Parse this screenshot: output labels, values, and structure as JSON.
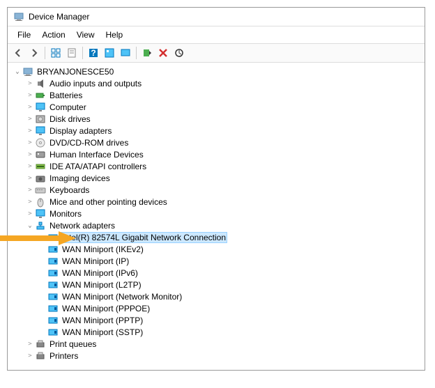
{
  "window": {
    "title": "Device Manager"
  },
  "menubar": {
    "items": [
      "File",
      "Action",
      "View",
      "Help"
    ]
  },
  "toolbar": {
    "buttons": [
      {
        "name": "back-icon"
      },
      {
        "name": "forward-icon"
      },
      {
        "sep": true
      },
      {
        "name": "show-hidden-icon"
      },
      {
        "name": "properties-icon"
      },
      {
        "sep": true
      },
      {
        "name": "help-icon"
      },
      {
        "name": "refresh-icon"
      },
      {
        "name": "view-icon"
      },
      {
        "sep": true
      },
      {
        "name": "update-driver-icon"
      },
      {
        "name": "disable-icon"
      },
      {
        "name": "scan-icon"
      }
    ]
  },
  "tree": {
    "root": {
      "label": "BRYANJONESCE50",
      "icon": "computer",
      "expanded": true,
      "children": [
        {
          "label": "Audio inputs and outputs",
          "icon": "audio",
          "hasChildren": true
        },
        {
          "label": "Batteries",
          "icon": "battery",
          "hasChildren": true
        },
        {
          "label": "Computer",
          "icon": "monitor",
          "hasChildren": true
        },
        {
          "label": "Disk drives",
          "icon": "disk",
          "hasChildren": true
        },
        {
          "label": "Display adapters",
          "icon": "monitor",
          "hasChildren": true
        },
        {
          "label": "DVD/CD-ROM drives",
          "icon": "cd",
          "hasChildren": true
        },
        {
          "label": "Human Interface Devices",
          "icon": "hid",
          "hasChildren": true
        },
        {
          "label": "IDE ATA/ATAPI controllers",
          "icon": "ide",
          "hasChildren": true
        },
        {
          "label": "Imaging devices",
          "icon": "camera",
          "hasChildren": true
        },
        {
          "label": "Keyboards",
          "icon": "keyboard",
          "hasChildren": true
        },
        {
          "label": "Mice and other pointing devices",
          "icon": "mouse",
          "hasChildren": true
        },
        {
          "label": "Monitors",
          "icon": "monitor",
          "hasChildren": true
        },
        {
          "label": "Network adapters",
          "icon": "network",
          "hasChildren": true,
          "expanded": true,
          "children": [
            {
              "label": "Intel(R) 82574L Gigabit Network Connection",
              "icon": "nic",
              "selected": true,
              "highlight": true
            },
            {
              "label": "WAN Miniport (IKEv2)",
              "icon": "nic"
            },
            {
              "label": "WAN Miniport (IP)",
              "icon": "nic"
            },
            {
              "label": "WAN Miniport (IPv6)",
              "icon": "nic"
            },
            {
              "label": "WAN Miniport (L2TP)",
              "icon": "nic"
            },
            {
              "label": "WAN Miniport (Network Monitor)",
              "icon": "nic"
            },
            {
              "label": "WAN Miniport (PPPOE)",
              "icon": "nic"
            },
            {
              "label": "WAN Miniport (PPTP)",
              "icon": "nic"
            },
            {
              "label": "WAN Miniport (SSTP)",
              "icon": "nic"
            }
          ]
        },
        {
          "label": "Print queues",
          "icon": "printer",
          "hasChildren": true
        },
        {
          "label": "Printers",
          "icon": "printer",
          "hasChildren": true
        }
      ]
    }
  },
  "annotation": {
    "arrowColor": "#f5a623"
  }
}
